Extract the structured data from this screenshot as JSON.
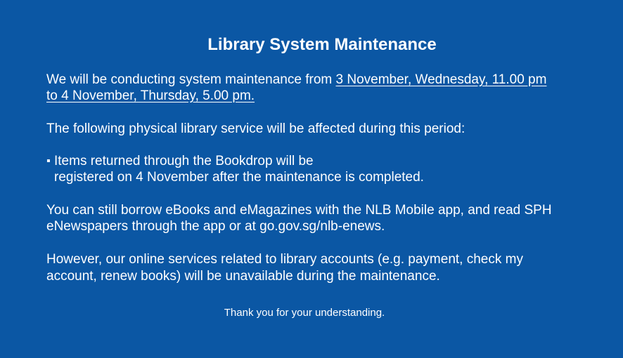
{
  "notice": {
    "title": "Library System Maintenance",
    "intro_prefix": "We will be conducting system maintenance from ",
    "intro_period_line1": "3 November, Wednesday, 11.00 pm",
    "intro_period_line2": "to 4 November, Thursday, 5.00 pm.",
    "affected_heading": "The following physical library service will be affected during this period:",
    "bullet_marker": "▪",
    "bullet_line1": "Items returned through the Bookdrop will be",
    "bullet_line2": "registered on 4 November after the maintenance is completed.",
    "ebooks_line1": "You can still borrow eBooks and eMagazines with the NLB Mobile app, and read SPH",
    "ebooks_line2": "eNewspapers through the app or at go.gov.sg/nlb-enews.",
    "online_line1": "However, our online services related to library accounts (e.g. payment, check my",
    "online_line2": "account, renew books) will be unavailable during the maintenance.",
    "closing": "Thank you for your understanding."
  },
  "colors": {
    "background": "#0b57a4",
    "text": "#ffffff"
  }
}
